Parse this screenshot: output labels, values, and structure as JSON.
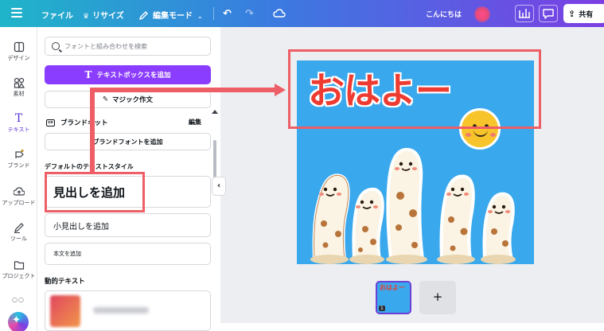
{
  "topbar": {
    "file": "ファイル",
    "resize": "リサイズ",
    "edit_mode": "編集モード",
    "greeting": "こんにちは",
    "share": "共有"
  },
  "rail": {
    "items": [
      {
        "label": "デザイン",
        "icon": "layout-icon"
      },
      {
        "label": "素材",
        "icon": "elements-icon"
      },
      {
        "label": "テキスト",
        "icon": "text-icon"
      },
      {
        "label": "ブランド",
        "icon": "brand-icon"
      },
      {
        "label": "アップロード",
        "icon": "upload-icon"
      },
      {
        "label": "ツール",
        "icon": "draw-icon"
      },
      {
        "label": "プロジェクト",
        "icon": "folder-icon"
      }
    ]
  },
  "panel": {
    "search_placeholder": "フォントと組み合わせを検索",
    "add_textbox": "テキストボックスを追加",
    "magic_write": "マジック作文",
    "brand_kit": "ブランドキット",
    "edit": "編集",
    "add_brand_font": "ブランドフォントを追加",
    "default_styles": "デフォルトのテキストスタイル",
    "add_heading": "見出しを追加",
    "add_subheading": "小見出しを追加",
    "add_body": "本文を追加",
    "dynamic_text": "動的テキスト"
  },
  "canvas": {
    "title_text": "おはよー",
    "background": "#3aa8ec",
    "title_color": "#ee3b31"
  },
  "pages": {
    "thumb_text": "おはよー",
    "page_number": "1",
    "add_page": "+"
  },
  "colors": {
    "accent_purple": "#8b3dff",
    "highlight_red": "#ee5e66"
  }
}
